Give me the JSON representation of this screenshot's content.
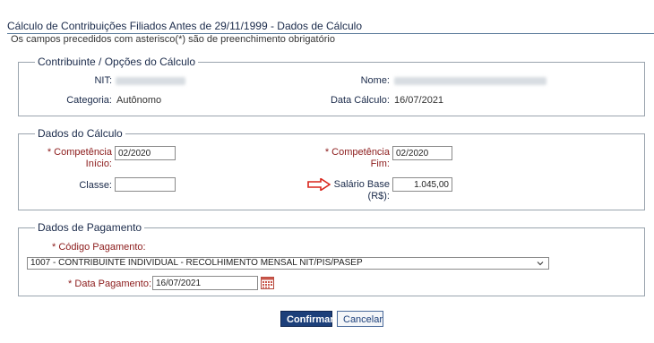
{
  "header": {
    "title": "Cálculo de Contribuições Filiados Antes de 29/11/1999 - Dados de Cálculo",
    "subtitle": "Os campos precedidos com asterisco(*) são de preenchimento obrigatório"
  },
  "contribuinte": {
    "legend": "Contribuinte / Opções do Cálculo",
    "nit_label": "NIT:",
    "nome_label": "Nome:",
    "categoria_label": "Categoria:",
    "categoria_value": "Autônomo",
    "data_calculo_label": "Data Cálculo:",
    "data_calculo_value": "16/07/2021"
  },
  "calculo": {
    "legend": "Dados do Cálculo",
    "competencia_inicio_label_1": "* Competência",
    "competencia_inicio_label_2": "Início:",
    "competencia_inicio_value": "02/2020",
    "competencia_fim_label_1": "* Competência",
    "competencia_fim_label_2": "Fim:",
    "competencia_fim_value": "02/2020",
    "classe_label": "Classe:",
    "classe_value": "",
    "salario_label_1": "Salário Base",
    "salario_label_2": "(R$):",
    "salario_value": "1.045,00",
    "arrow_color": "#d9251c"
  },
  "pagamento": {
    "legend": "Dados de Pagamento",
    "codigo_label": "* Código Pagamento:",
    "codigo_value": "1007 - CONTRIBUINTE INDIVIDUAL - RECOLHIMENTO MENSAL NIT/PIS/PASEP",
    "data_label": "* Data Pagamento:",
    "data_value": "16/07/2021",
    "calendar_icon": "calendar-icon"
  },
  "buttons": {
    "confirm_label": "Confirmar",
    "cancel_label": "Cancelar"
  }
}
